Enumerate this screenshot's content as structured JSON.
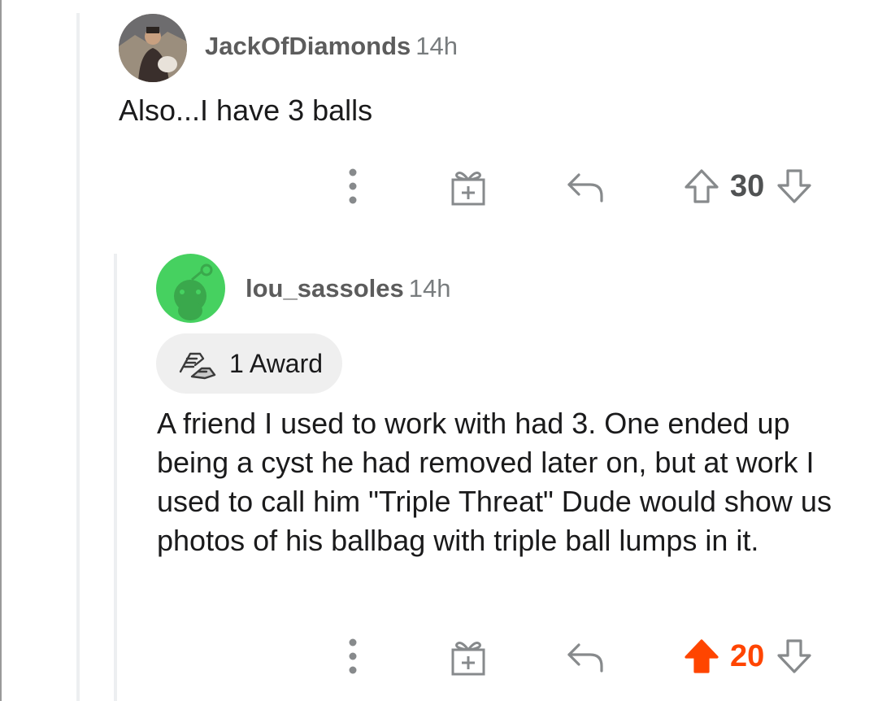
{
  "comments": [
    {
      "username": "JackOfDiamonds",
      "time": "14h",
      "body": "Also...I have 3 balls",
      "score": "30",
      "upvoted": false
    },
    {
      "username": "lou_sassoles",
      "time": "14h",
      "award_label": "1 Award",
      "body": "A friend I used to work with had 3.  One ended up being a cyst he had removed later on,  but at work I used to call him \"Triple Threat\"  Dude would show us photos of his ballbag with triple ball lumps in it.",
      "score": "20",
      "upvoted": true
    }
  ],
  "colors": {
    "upvote_active": "#ff4500",
    "icon_gray": "#878a8c",
    "avatar_green": "#46d160"
  },
  "icons": [
    "more-options-icon",
    "gift-award-icon",
    "reply-icon",
    "upvote-icon",
    "downvote-icon",
    "snoo-icon",
    "handshake-award-icon"
  ]
}
